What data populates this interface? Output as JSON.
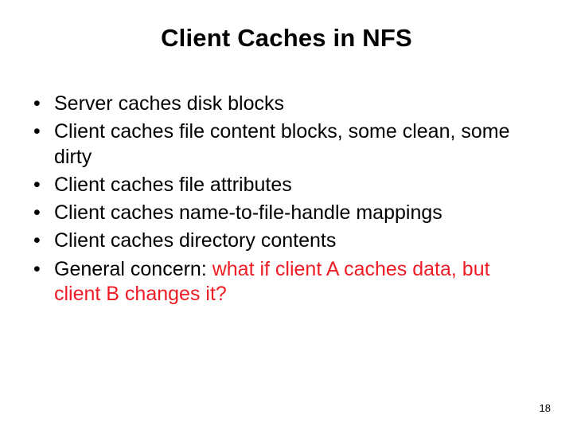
{
  "slide": {
    "title": "Client Caches in NFS",
    "bullets": [
      {
        "text": "Server caches disk blocks"
      },
      {
        "text": "Client caches file content blocks, some clean, some dirty"
      },
      {
        "text": "Client caches file attributes"
      },
      {
        "text": "Client caches name-to-file-handle mappings"
      },
      {
        "text": "Client caches directory contents"
      },
      {
        "prefix": "General concern: ",
        "emphasis": "what if client A caches data, but client B changes it?"
      }
    ],
    "page_number": "18"
  }
}
